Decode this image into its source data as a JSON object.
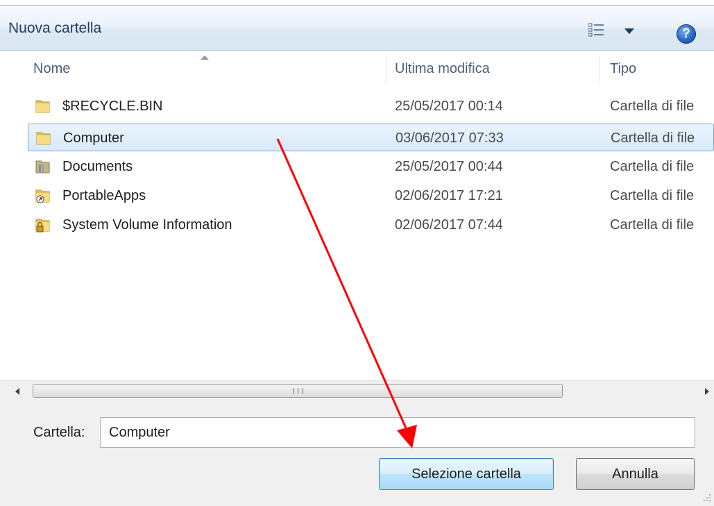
{
  "toolbar": {
    "new_folder_label": "Nuova cartella",
    "view_icon": "view-details-icon",
    "help_icon": "help-icon",
    "help_glyph": "?"
  },
  "columns": {
    "name": "Nome",
    "modified": "Ultima modifica",
    "type": "Tipo"
  },
  "files": [
    {
      "name": "$RECYCLE.BIN",
      "modified": "25/05/2017 00:14",
      "type": "Cartella di file",
      "icon": "folder-icon"
    },
    {
      "name": "Computer",
      "modified": "03/06/2017 07:33",
      "type": "Cartella di file",
      "icon": "folder-icon",
      "selected": true
    },
    {
      "name": "Documents",
      "modified": "25/05/2017 00:44",
      "type": "Cartella di file",
      "icon": "library-folder-icon"
    },
    {
      "name": "PortableApps",
      "modified": "02/06/2017 17:21",
      "type": "Cartella di file",
      "icon": "shortcut-folder-icon"
    },
    {
      "name": "System Volume Information",
      "modified": "02/06/2017 07:44",
      "type": "Cartella di file",
      "icon": "locked-folder-icon"
    }
  ],
  "footer": {
    "folder_label": "Cartella:",
    "folder_value": "Computer",
    "select_button": "Selezione cartella",
    "cancel_button": "Annulla"
  },
  "colors": {
    "annotation_arrow": "#ff0000",
    "selection": "#d6e9fb",
    "primary_button_border": "#3c7fb1"
  }
}
